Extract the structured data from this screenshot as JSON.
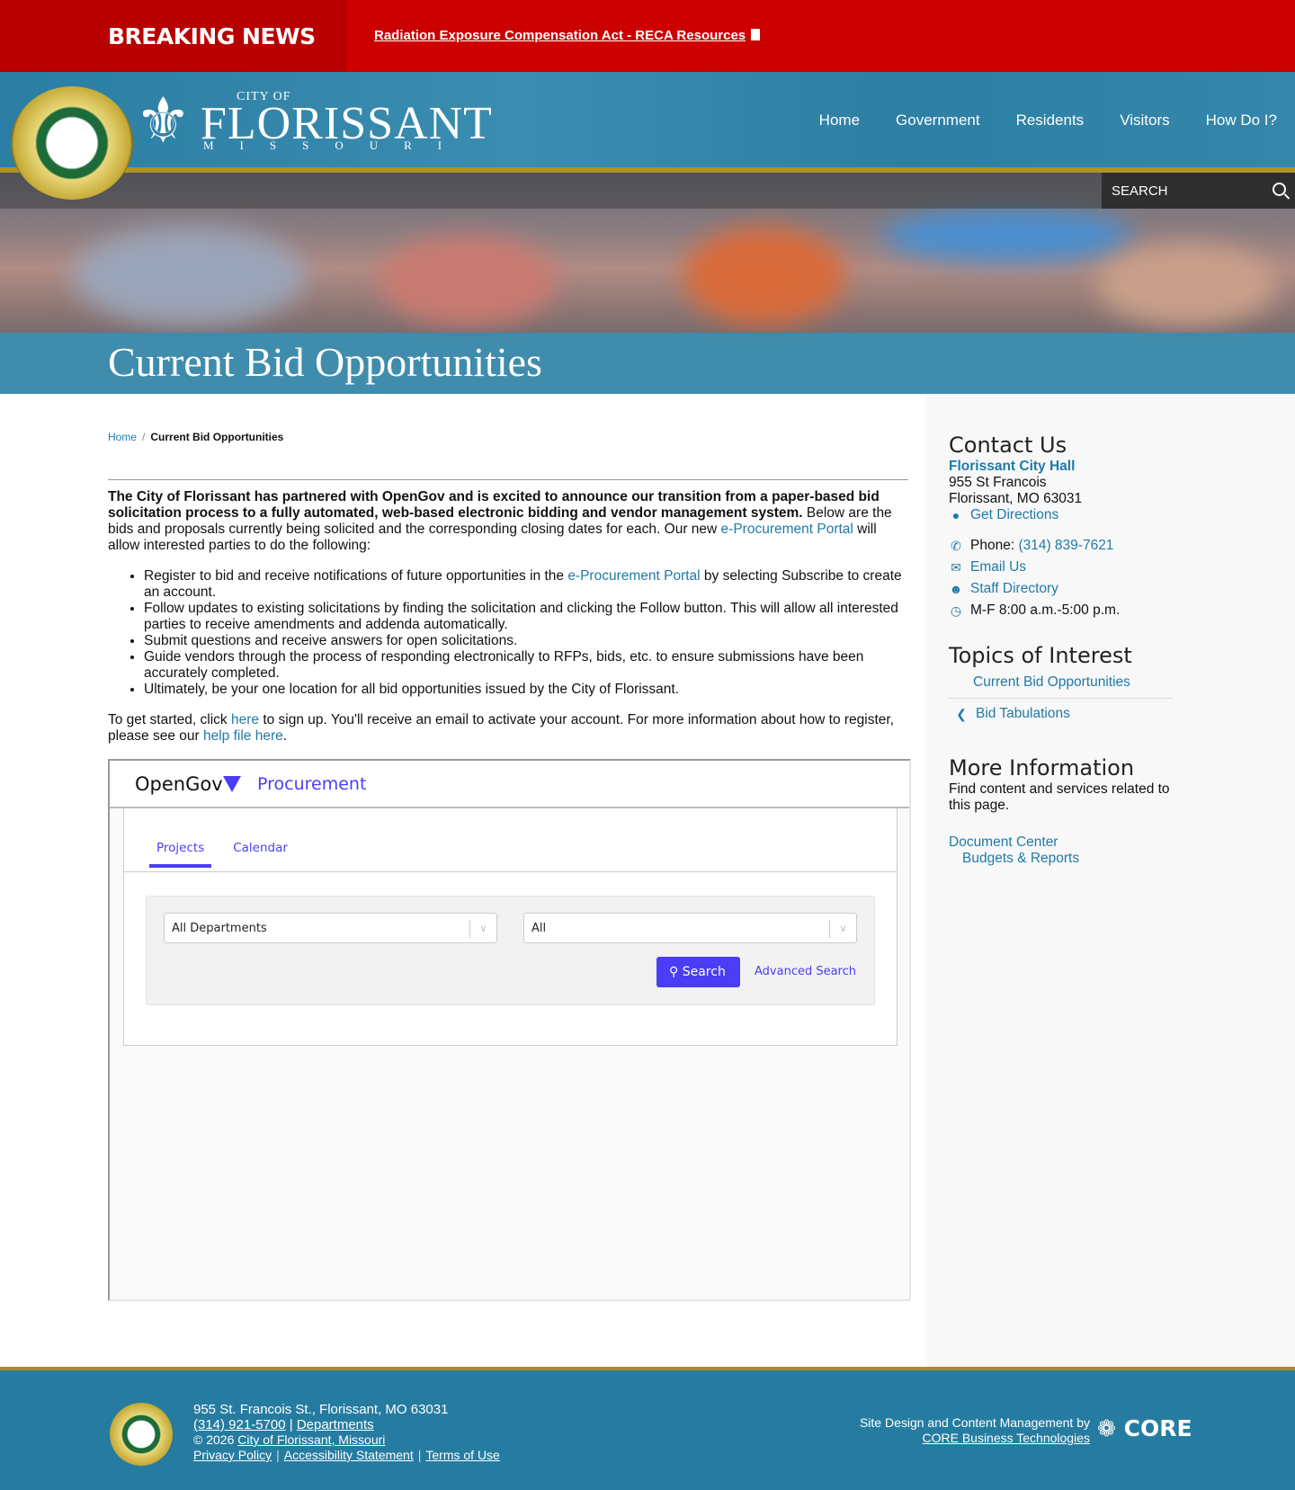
{
  "breaking": {
    "label": "BREAKING NEWS",
    "headline": "Radiation Exposure Compensation Act - RECA Resources"
  },
  "logo": {
    "city_of": "CITY OF",
    "name": "FLORISSANT",
    "state": "MISSOURI"
  },
  "nav": [
    "Home",
    "Government",
    "Residents",
    "Visitors",
    "How Do I?"
  ],
  "search": {
    "placeholder": "SEARCH"
  },
  "page_title": "Current Bid Opportunities",
  "breadcrumb": {
    "home": "Home",
    "current": "Current Bid Opportunities"
  },
  "intro": {
    "bold": "The City of Florissant has partnered with OpenGov and is excited to announce our transition from a paper-based bid solicitation process to a fully automated, web-based electronic bidding and vendor management system.",
    "text1": " Below are the bids and proposals currently being solicited and the corresponding closing dates for each.  Our new ",
    "portal_link": "e-Procurement Portal",
    "text2": " will allow interested parties to do the following:",
    "bullet1a": "Register to bid and receive notifications of future opportunities in the ",
    "bullet1b": " by selecting Subscribe to create an account.",
    "bullets": [
      "Follow updates to existing solicitations by finding the solicitation and clicking the Follow button. This will allow all interested parties to receive amendments and addenda automatically.",
      "Submit questions and receive answers for open solicitations.",
      "Guide vendors through the process of responding electronically to RFPs, bids, etc. to ensure submissions have been accurately completed.",
      "Ultimately, be your one location for all bid opportunities issued by the City of Florissant."
    ],
    "start1": "To get started, click ",
    "here": "here",
    "start2": " to sign up. You'll receive an email to activate your account. For more information about how to register, please see our ",
    "help": "help file here",
    "end": "."
  },
  "widget": {
    "brand": "OpenGov",
    "product": "Procurement",
    "tabs": [
      "Projects",
      "Calendar"
    ],
    "department": "All Departments",
    "status": "All",
    "search": "Search",
    "advanced": "Advanced Search"
  },
  "sidebar": {
    "contact_title": "Contact Us",
    "office": "Florissant City Hall",
    "street": "955 St Francois",
    "citystate": "Florissant, MO 63031",
    "directions": "Get Directions",
    "phone_label": "Phone: ",
    "phone": "(314) 839-7621",
    "email": "Email Us",
    "staff": "Staff Directory",
    "hours": "M-F 8:00 a.m.-5:00 p.m.",
    "topics_title": "Topics of Interest",
    "topics": [
      "Current Bid Opportunities",
      "Bid Tabulations"
    ],
    "more_title": "More Information",
    "more_text": "Find content and services related to this page.",
    "doc_center": "Document Center",
    "budgets": "Budgets & Reports"
  },
  "footer": {
    "address": "955 St. Francois St., Florissant, MO 63031",
    "phone": "(314) 921-5700",
    "departments": "Departments",
    "copyright": "© 2026 ",
    "copyright_link": "City of Florissant, Missouri",
    "links": [
      "Privacy Policy",
      "Accessibility Statement",
      "Terms of Use"
    ],
    "credit": "Site Design and Content Management by",
    "credit_link": "CORE Business Technologies",
    "core": "CORE"
  }
}
